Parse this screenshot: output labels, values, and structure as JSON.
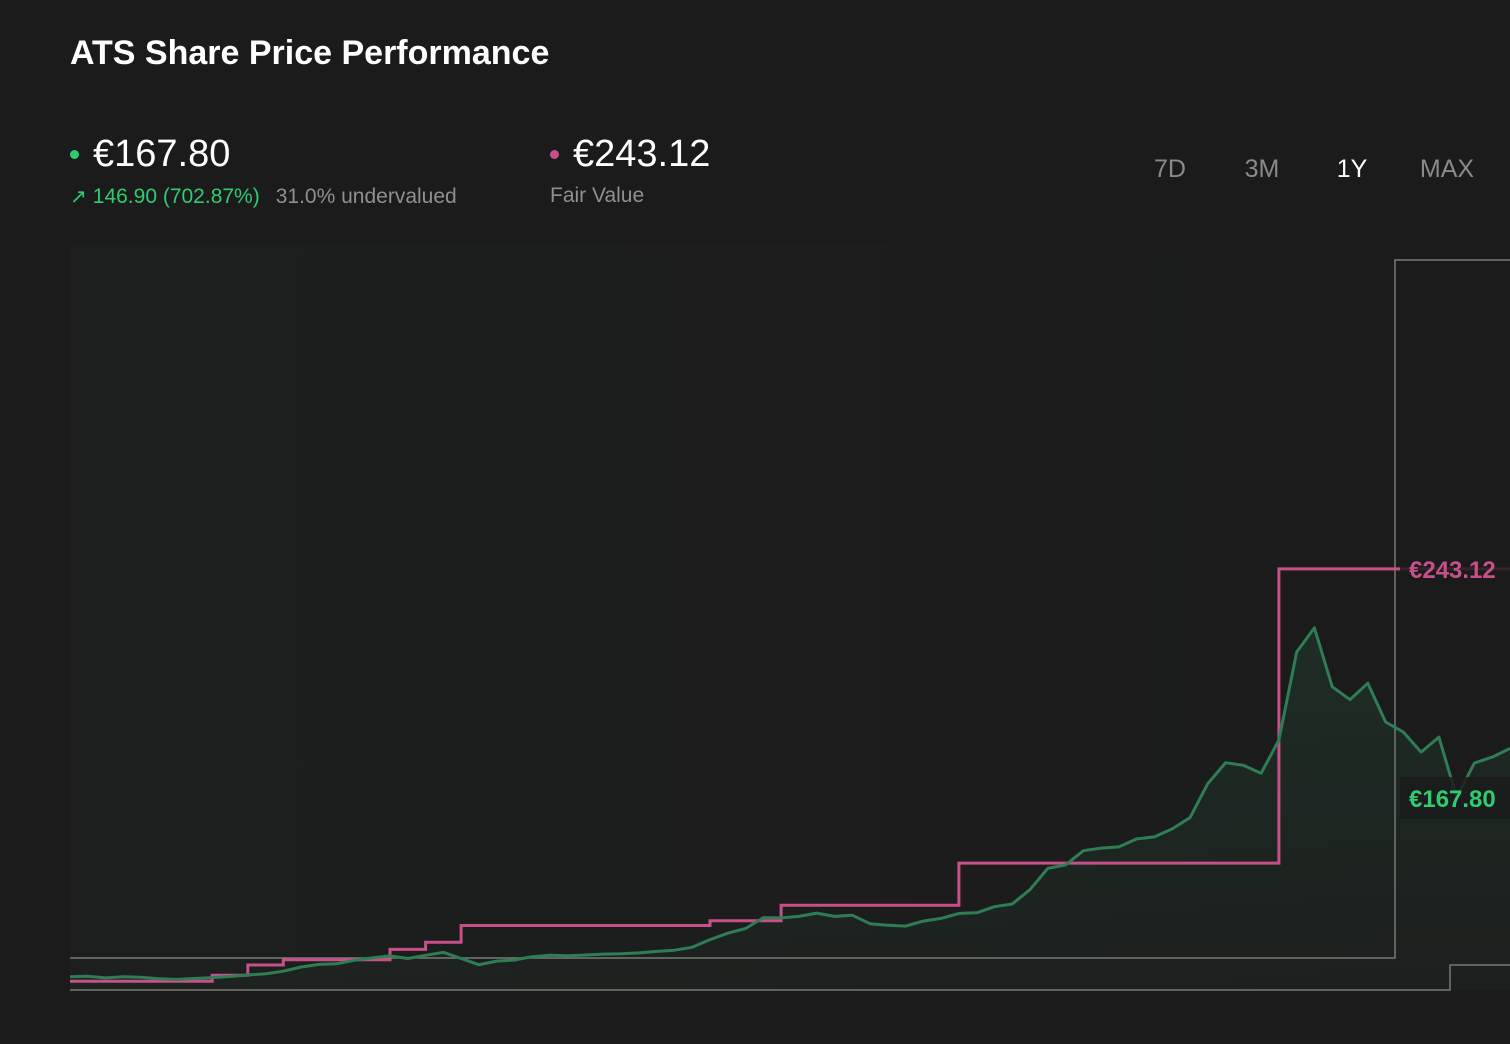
{
  "header": {
    "title": "ATS Share Price Performance"
  },
  "price_stat": {
    "value": "€167.80",
    "change_arrow": "arrow-up-right-icon",
    "change": "146.90 (702.87%)",
    "status": "31.0% undervalued",
    "color": "#2ecc71"
  },
  "fair_value_stat": {
    "value": "€243.12",
    "label": "Fair Value",
    "color": "#c7508a"
  },
  "time_ranges": [
    {
      "label": "7D",
      "active": false
    },
    {
      "label": "3M",
      "active": false
    },
    {
      "label": "1Y",
      "active": true
    },
    {
      "label": "MAX",
      "active": false
    }
  ],
  "chart_data": {
    "type": "line",
    "title": "ATS Share Price Performance",
    "xlabel": "",
    "ylabel": "",
    "grid": false,
    "legend": "none",
    "y_range": [
      17,
      270
    ],
    "series": [
      {
        "name": "",
        "color": "#2e7d55",
        "values": [
          21.5,
          21.7,
          21.1,
          21.5,
          21.3,
          20.8,
          20.6,
          20.9,
          21.2,
          21.6,
          22.1,
          22.5,
          23.4,
          24.8,
          25.7,
          25.9,
          27.1,
          27.9,
          28.6,
          27.7,
          28.8,
          29.8,
          27.7,
          25.6,
          26.8,
          27.2,
          28.3,
          28.8,
          28.6,
          28.9,
          29.2,
          29.3,
          29.6,
          30.1,
          30.5,
          31.5,
          34.1,
          36.3,
          37.9,
          41.6,
          41.5,
          42.0,
          43.1,
          42.0,
          42.4,
          39.5,
          39.0,
          38.7,
          40.4,
          41.3,
          43.0,
          43.2,
          45.3,
          46.2,
          51.1,
          58.3,
          59.5,
          64.3,
          65.2,
          65.6,
          68.3,
          69.0,
          71.7,
          75.5,
          87.1,
          94.2,
          93.3,
          90.6,
          101.9,
          131.8,
          140.0,
          120.0,
          115.6,
          121.2,
          108.0,
          104.6,
          97.8,
          102.9,
          82.4,
          94.1,
          96.1,
          99.0
        ]
      },
      {
        "name": "Fair Value",
        "color": "#c7508a",
        "values": [
          20.0,
          20.0,
          20.0,
          20.0,
          20.0,
          20.0,
          20.0,
          20.0,
          22.0,
          22.0,
          25.5,
          25.5,
          27.3,
          27.3,
          27.3,
          27.3,
          27.3,
          27.3,
          30.8,
          30.8,
          33.2,
          33.2,
          38.9,
          38.9,
          38.9,
          38.9,
          38.9,
          38.9,
          38.9,
          38.9,
          38.9,
          38.9,
          38.9,
          38.9,
          38.9,
          38.9,
          40.5,
          40.5,
          40.5,
          40.5,
          45.8,
          45.8,
          45.8,
          45.8,
          45.8,
          45.8,
          45.8,
          45.8,
          45.8,
          45.8,
          60.1,
          60.1,
          60.1,
          60.1,
          60.1,
          60.1,
          60.1,
          60.1,
          60.1,
          60.1,
          60.1,
          60.1,
          60.1,
          60.1,
          60.1,
          60.1,
          60.1,
          60.1,
          160.0,
          160.0,
          160.0,
          160.0,
          160.0,
          160.0,
          160.0,
          160.0,
          160.0,
          160.0,
          160.0,
          160.0,
          160.0,
          160.0
        ]
      }
    ],
    "end_labels": [
      {
        "series": "Fair Value",
        "text": "€243.12"
      },
      {
        "series": "Price",
        "text": "€167.80"
      }
    ]
  }
}
